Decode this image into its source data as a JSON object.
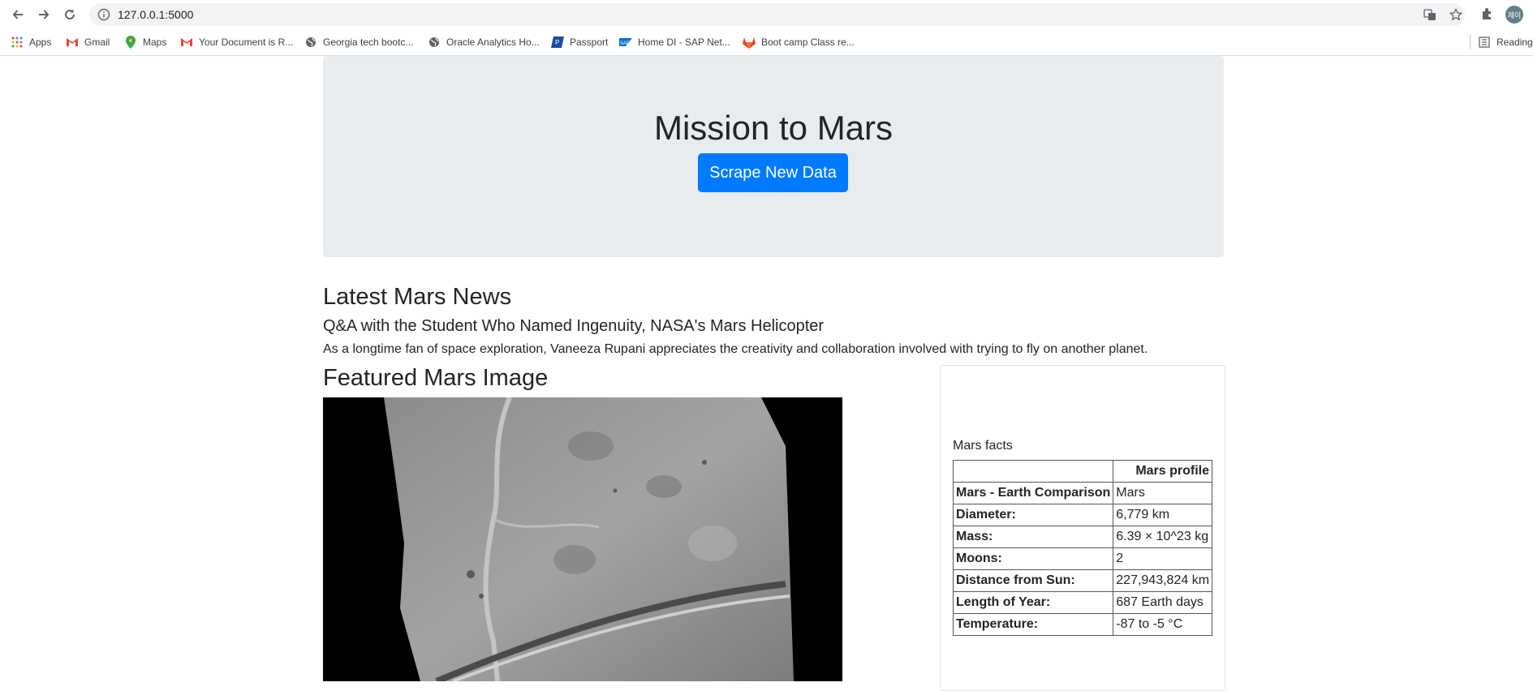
{
  "browser": {
    "url": "127.0.0.1:5000",
    "profile_initial": "제이",
    "reading_list_label": "Reading",
    "bookmarks": [
      {
        "label": "Apps",
        "icon": "apps-grid-icon"
      },
      {
        "label": "Gmail",
        "icon": "gmail-icon"
      },
      {
        "label": "Maps",
        "icon": "maps-pin-icon"
      },
      {
        "label": "Your Document is R...",
        "icon": "gmail-icon"
      },
      {
        "label": "Georgia tech bootc...",
        "icon": "globe-icon"
      },
      {
        "label": "Oracle Analytics Ho...",
        "icon": "globe-icon"
      },
      {
        "label": "Passport",
        "icon": "passport-icon"
      },
      {
        "label": "Home DI - SAP Net...",
        "icon": "sap-icon"
      },
      {
        "label": "Boot camp Class re...",
        "icon": "gitlab-icon"
      }
    ]
  },
  "page": {
    "title": "Mission to Mars",
    "scrape_button": "Scrape New Data",
    "news_heading": "Latest Mars News",
    "news_title": "Q&A with the Student Who Named Ingenuity, NASA's Mars Helicopter",
    "news_teaser": "As a longtime fan of space exploration, Vaneeza Rupani appreciates the creativity and collaboration involved with trying to fly on another planet.",
    "image_heading": "Featured Mars Image",
    "facts_caption": "Mars facts",
    "facts_header": [
      "",
      "Mars profile"
    ],
    "facts_rows": [
      {
        "label": "Mars - Earth Comparison",
        "value": "Mars"
      },
      {
        "label": "Diameter:",
        "value": "6,779 km"
      },
      {
        "label": "Mass:",
        "value": "6.39 × 10^23 kg"
      },
      {
        "label": "Moons:",
        "value": "2"
      },
      {
        "label": "Distance from Sun:",
        "value": "227,943,824 km"
      },
      {
        "label": "Length of Year:",
        "value": "687 Earth days"
      },
      {
        "label": "Temperature:",
        "value": "-87 to -5 °C"
      }
    ]
  },
  "colors": {
    "jumbotron_bg": "#e9ecef",
    "button_primary": "#007bff",
    "text": "#212529"
  }
}
